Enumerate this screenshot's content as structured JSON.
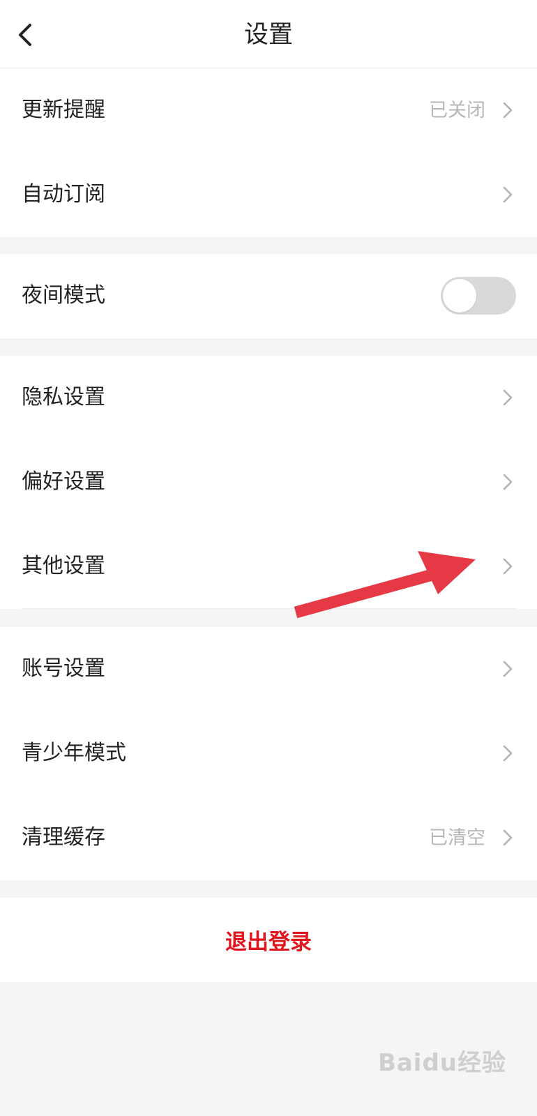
{
  "header": {
    "title": "设置",
    "back_icon": "chevron-left-icon"
  },
  "groups": [
    {
      "items": [
        {
          "label": "更新提醒",
          "value": "已关闭",
          "chevron": true
        },
        {
          "label": "自动订阅",
          "value": "",
          "chevron": true
        }
      ]
    },
    {
      "items": [
        {
          "label": "夜间模式",
          "toggle": {
            "on": false
          }
        }
      ]
    },
    {
      "items": [
        {
          "label": "隐私设置",
          "chevron": true
        },
        {
          "label": "偏好设置",
          "chevron": true
        },
        {
          "label": "其他设置",
          "chevron": true
        }
      ]
    },
    {
      "items": [
        {
          "label": "账号设置",
          "chevron": true
        },
        {
          "label": "青少年模式",
          "chevron": true
        },
        {
          "label": "清理缓存",
          "value": "已清空",
          "chevron": true
        }
      ]
    }
  ],
  "logout": {
    "label": "退出登录",
    "color": "#e0161d"
  },
  "annotation": {
    "arrow_color": "#e53945",
    "target": "其他设置"
  },
  "watermark": {
    "text": "Baidu经验"
  },
  "colors": {
    "background": "#f5f5f7",
    "card": "#ffffff",
    "text": "#222222",
    "secondary_text": "#b7b7b7",
    "toggle_off": "#d9d9d9"
  }
}
